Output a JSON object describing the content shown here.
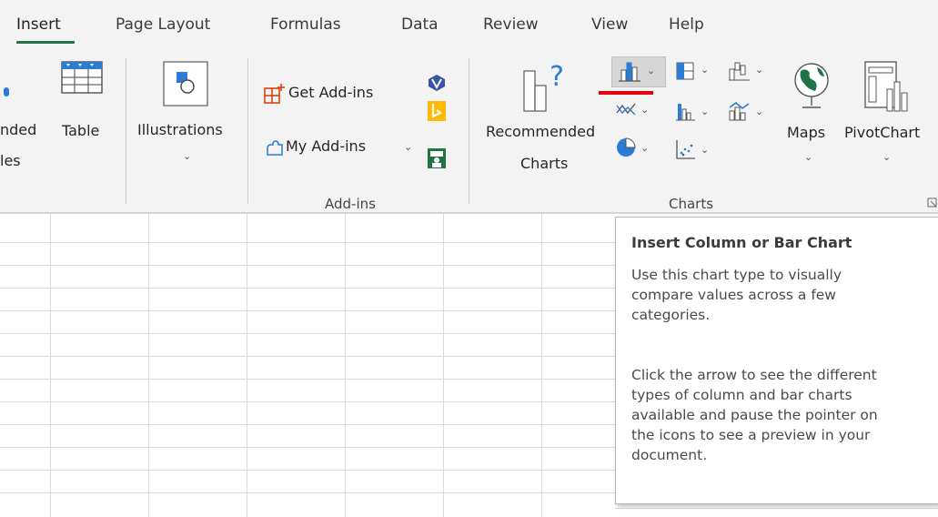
{
  "tabs": [
    {
      "label": "Insert"
    },
    {
      "label": "Page Layout"
    },
    {
      "label": "Formulas"
    },
    {
      "label": "Data"
    },
    {
      "label": "Review"
    },
    {
      "label": "View"
    },
    {
      "label": "Help"
    }
  ],
  "ribbon": {
    "tables_partial": {
      "line1": "nded",
      "line2": "les"
    },
    "table": {
      "label": "Table"
    },
    "illustrations": {
      "label": "Illustrations"
    },
    "addins": {
      "get_addins": "Get Add-ins",
      "my_addins": "My Add-ins",
      "group_label": "Add-ins"
    },
    "charts": {
      "recommended_line1": "Recommended",
      "recommended_line2": "Charts",
      "group_label": "Charts",
      "maps": "Maps",
      "pivotchart": "PivotChart"
    }
  },
  "tooltip": {
    "title": "Insert Column or Bar Chart",
    "para1": [
      "Use this chart type to visually",
      "compare values across a few",
      "categories."
    ],
    "para2": [
      "Click the arrow to see the different",
      "types of column and bar charts",
      "available and pause the pointer on",
      "the icons to see a preview in your",
      "document."
    ]
  },
  "colors": {
    "accent_green": "#217346",
    "annotation_red": "#e3000f",
    "ribbon_bg": "#f3f3f3"
  }
}
